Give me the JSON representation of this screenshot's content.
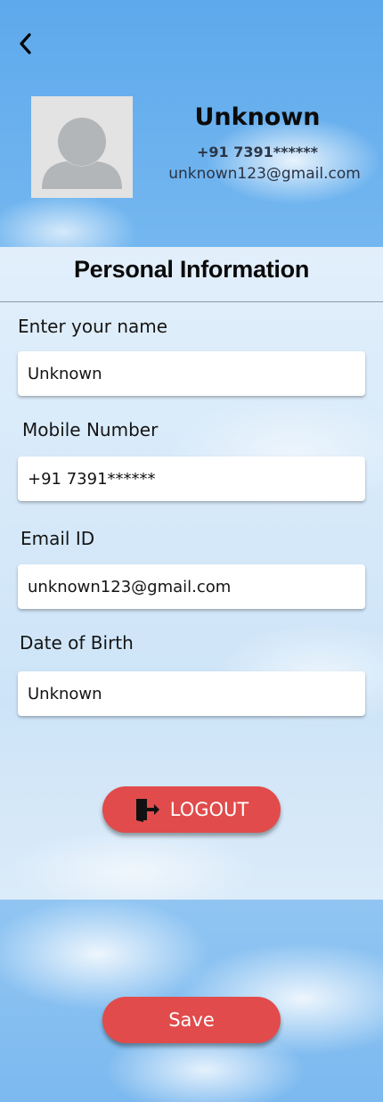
{
  "header": {
    "back_icon": "chevron-left-icon",
    "avatar_icon": "person-placeholder-icon",
    "name": "Unknown",
    "phone": "+91 7391******",
    "email": "unknown123@gmail.com"
  },
  "personal_info": {
    "title": "Personal Information",
    "fields": [
      {
        "label": "Enter your name",
        "value": "Unknown"
      },
      {
        "label": "Mobile Number",
        "value": "+91 7391******"
      },
      {
        "label": "Email ID",
        "value": "unknown123@gmail.com"
      },
      {
        "label": "Date of Birth",
        "value": "Unknown"
      }
    ]
  },
  "actions": {
    "logout_icon": "logout-door-icon",
    "logout_label": "LOGOUT",
    "save_label": "Save"
  },
  "colors": {
    "button": "#e14b4b",
    "sky": "#7cbcf1",
    "panel": "#d6e9f9"
  }
}
